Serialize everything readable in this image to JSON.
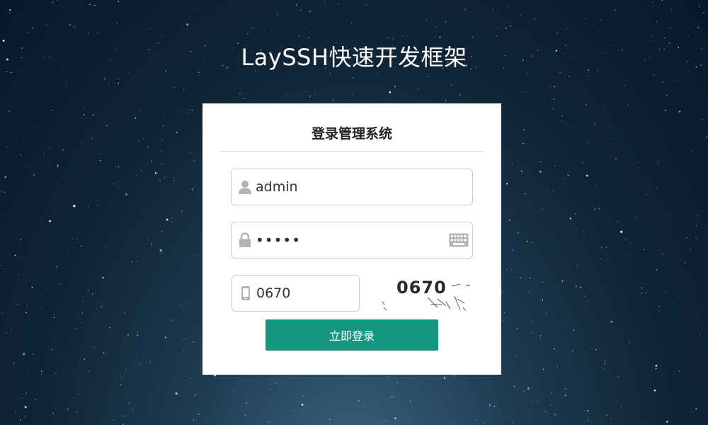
{
  "page": {
    "title": "LaySSH快速开发框架"
  },
  "login": {
    "heading": "登录管理系统",
    "username": {
      "value": "admin",
      "icon": "user-icon"
    },
    "password": {
      "value": "admin",
      "icon": "lock-icon",
      "keyboard_icon": "keyboard-icon"
    },
    "captcha": {
      "value": "0670",
      "icon": "phone-icon",
      "image_text": "0670"
    },
    "submit_label": "立即登录"
  },
  "colors": {
    "button": "#16967f",
    "icon": "#b3b3b3",
    "card": "#ffffff"
  }
}
